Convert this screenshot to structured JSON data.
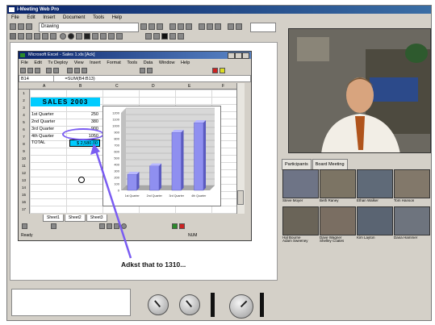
{
  "app": {
    "title": "i-Meeting Web Pro"
  },
  "menu": [
    "File",
    "Edit",
    "Insert",
    "Document",
    "Tools",
    "Help"
  ],
  "toolbar": {
    "font_name": "Drawing",
    "zoom": ""
  },
  "excel": {
    "title": "Microsoft Excel - Sales 1.xls [Ack]",
    "menu": [
      "File",
      "Edit",
      "Tv Deploy",
      "View",
      "Insert",
      "Format",
      "Tools",
      "Data",
      "Window",
      "Help"
    ],
    "cell_ref": "B14",
    "formula": "=SUM(B4:B13)",
    "columns": [
      "A",
      "B",
      "C",
      "D",
      "E",
      "F"
    ],
    "rows": [
      "1",
      "2",
      "3",
      "4",
      "5",
      "6",
      "7",
      "8",
      "9",
      "10",
      "11",
      "12",
      "13",
      "14",
      "15",
      "16",
      "17"
    ],
    "sheet_title": "SALES 2003",
    "items": [
      {
        "label": "1st Quarter",
        "value": "250"
      },
      {
        "label": "2nd Quarter",
        "value": "380"
      },
      {
        "label": "3rd Quarter",
        "value": "900"
      },
      {
        "label": "4th Quarter",
        "value": "1050"
      }
    ],
    "total_label": "TOTAL",
    "total_value": "$ 2,580.00",
    "sheet_tabs": [
      "Sheet1",
      "Sheet2",
      "Sheet3"
    ],
    "status": "Ready",
    "status_right": "NUM"
  },
  "chart_data": {
    "type": "bar",
    "categories": [
      "1st Quarter",
      "2nd Quarter",
      "3rd Quarter",
      "4th Quarter"
    ],
    "values": [
      250,
      380,
      900,
      1050
    ],
    "ylim": [
      0,
      1200
    ],
    "yticks": [
      "1200",
      "1100",
      "1000",
      "900",
      "800",
      "700",
      "600",
      "500",
      "400",
      "300",
      "200",
      "100",
      "0"
    ],
    "bar_color": "#8f8ff0",
    "grid": true
  },
  "annotation": {
    "text": "Adkst that to 1310..."
  },
  "attendee_tabs": [
    "Participants",
    "Board Meeting"
  ],
  "attendees": [
    {
      "name": "Steve Moyer"
    },
    {
      "name": "Beth Raney"
    },
    {
      "name": "Ethan Walker"
    },
    {
      "name": "Tom Hanson"
    },
    {
      "name": "Hal Bourne"
    },
    {
      "name": "Dave Wagner"
    },
    {
      "name": "Kim Layton"
    },
    {
      "name": "Dana Hammer"
    },
    {
      "name": "Adam Sweeney"
    },
    {
      "name": "Shelley Coates"
    }
  ],
  "colors": {
    "accent_cyan": "#00ccff",
    "annotation_purple": "#7a5cf2",
    "title_blue": "#0a246a"
  }
}
